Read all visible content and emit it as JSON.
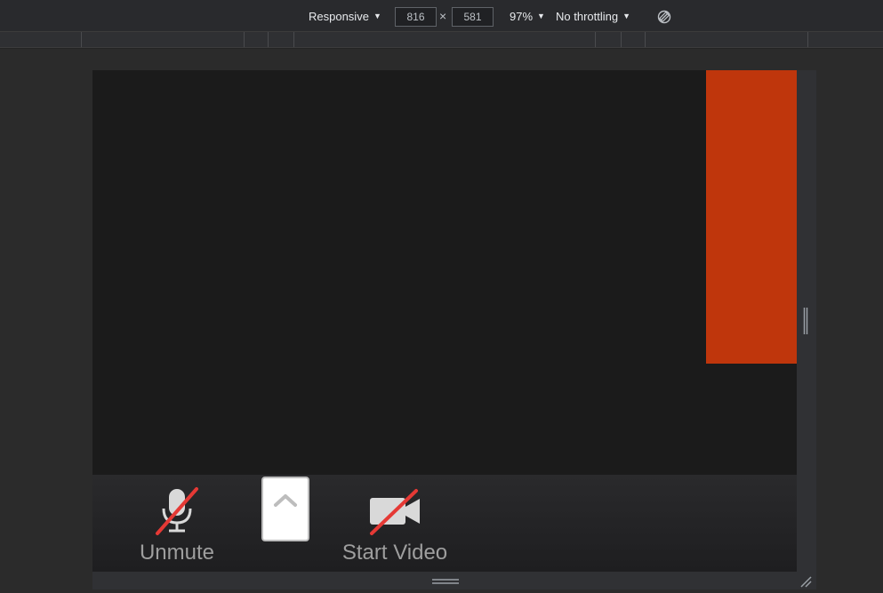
{
  "toolbar": {
    "device_mode": "Responsive",
    "width_value": "816",
    "height_value": "581",
    "times": "×",
    "zoom": "97%",
    "throttling": "No throttling"
  },
  "meeting": {
    "controls": {
      "unmute_label": "Unmute",
      "start_video_label": "Start Video"
    },
    "colors": {
      "self_view": "#bf360c",
      "mute_slash": "#e53935"
    }
  }
}
